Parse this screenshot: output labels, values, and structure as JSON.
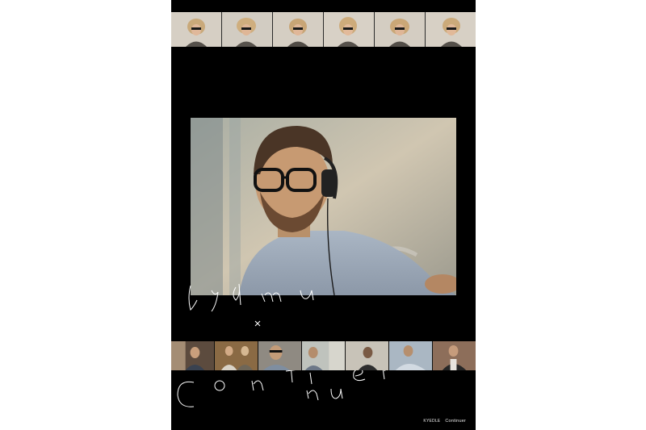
{
  "poster": {
    "background": "#000000",
    "handwriting_top": "Lydmu",
    "handwriting_x": "×",
    "handwriting_bottom": "Con  ti  nuer",
    "credits": {
      "brand_one": "KYEDLE",
      "brand_two": "Continuer"
    }
  },
  "strips": {
    "top_frames": 6,
    "bottom_frames": 7
  }
}
